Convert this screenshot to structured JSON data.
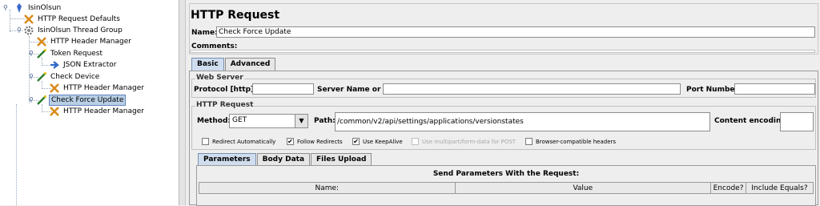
{
  "tree": {
    "items": [
      {
        "label": "IsinOlsun"
      },
      {
        "label": "HTTP Request Defaults"
      },
      {
        "label": "IsinOlsun Thread Group"
      },
      {
        "label": "HTTP Header Manager"
      },
      {
        "label": "Token Request"
      },
      {
        "label": "JSON Extractor"
      },
      {
        "label": "Check Device"
      },
      {
        "label": "HTTP Header Manager"
      },
      {
        "label": "Check Force Update"
      },
      {
        "label": "HTTP Header Manager"
      }
    ]
  },
  "main": {
    "title": "HTTP Request",
    "name_label": "Name:",
    "name_value": "Check Force Update",
    "comments_label": "Comments:",
    "tabs": [
      {
        "label": "Basic"
      },
      {
        "label": "Advanced"
      }
    ],
    "web_server": {
      "title": "Web Server",
      "protocol_label": "Protocol [http]:",
      "server_label": "Server Name or IP:",
      "port_label": "Port Number:"
    },
    "http_request": {
      "title": "HTTP Request",
      "method_label": "Method:",
      "method_value": "GET",
      "path_label": "Path:",
      "path_value": "/common/v2/api/settings/applications/versionstates",
      "encoding_label": "Content encoding:"
    },
    "checkboxes": [
      {
        "label": "Redirect Automatically",
        "checked": false
      },
      {
        "label": "Follow Redirects",
        "checked": true
      },
      {
        "label": "Use KeepAlive",
        "checked": true
      },
      {
        "label": "Use multipart/form-data for POST",
        "checked": false
      },
      {
        "label": "Browser-compatible headers",
        "checked": false
      }
    ],
    "subtabs": [
      {
        "label": "Parameters"
      },
      {
        "label": "Body Data"
      },
      {
        "label": "Files Upload"
      }
    ],
    "params": {
      "caption": "Send Parameters With the Request:",
      "columns": [
        "Name:",
        "Value",
        "Encode?",
        "Include Equals?"
      ]
    }
  }
}
